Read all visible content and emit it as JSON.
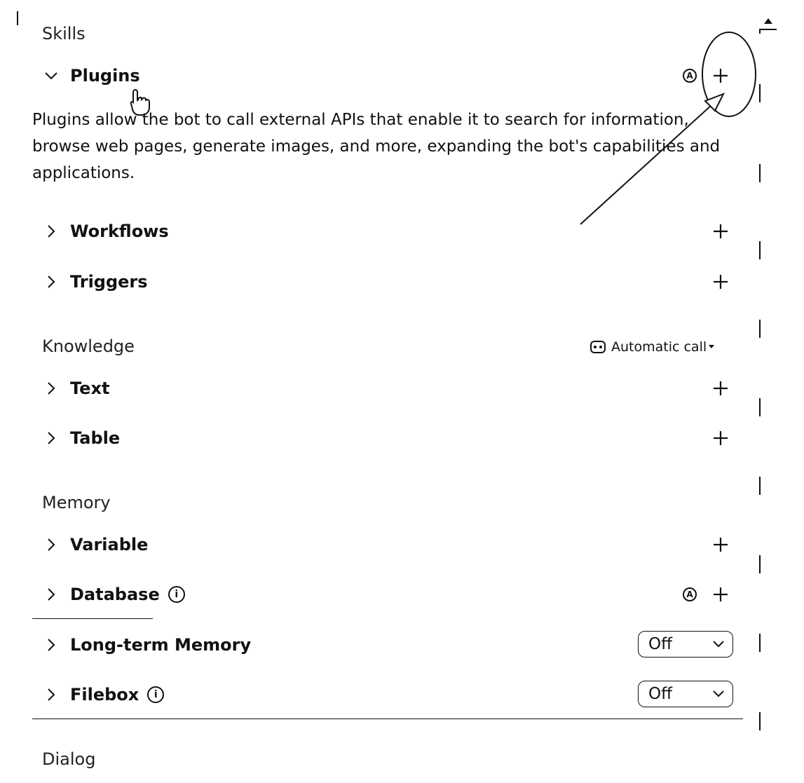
{
  "skills": {
    "title": "Skills",
    "plugins": {
      "label": "Plugins",
      "badge": "A",
      "description": "Plugins allow the bot to call external APIs that enable it to search for information, browse web pages, generate images, and more, expanding the bot's capabilities and applications."
    },
    "workflows": {
      "label": "Workflows"
    },
    "triggers": {
      "label": "Triggers"
    }
  },
  "knowledge": {
    "title": "Knowledge",
    "call_mode": "Automatic call",
    "text": {
      "label": "Text"
    },
    "table": {
      "label": "Table"
    }
  },
  "memory": {
    "title": "Memory",
    "variable": {
      "label": "Variable"
    },
    "database": {
      "label": "Database",
      "info": "i",
      "badge": "A"
    },
    "long_term": {
      "label": "Long-term Memory",
      "value": "Off"
    },
    "filebox": {
      "label": "Filebox",
      "info": "i",
      "value": "Off"
    }
  },
  "dialog": {
    "title": "Dialog"
  }
}
